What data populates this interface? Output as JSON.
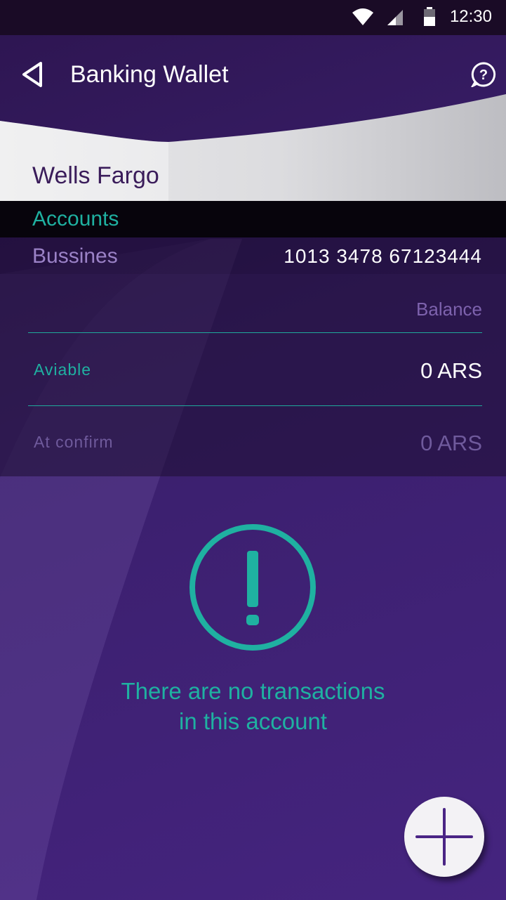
{
  "status_bar": {
    "time": "12:30",
    "icons": [
      "wifi-icon",
      "signal-icon",
      "battery-icon"
    ]
  },
  "header": {
    "title": "Banking Wallet",
    "back_icon": "back-arrow-icon",
    "help_icon": "help-icon"
  },
  "bank": {
    "name": "Wells Fargo"
  },
  "accounts": {
    "section_label": "Accounts",
    "selected": {
      "type": "Bussines",
      "number": "1013 3478 67123444"
    }
  },
  "balance": {
    "header": "Balance",
    "rows": [
      {
        "label": "Aviable",
        "value": "0 ARS"
      },
      {
        "label": "At confirm",
        "value": "0 ARS"
      }
    ]
  },
  "empty_state": {
    "icon": "alert-icon",
    "line1": "There are no transactions",
    "line2": "in this account"
  },
  "fab": {
    "icon": "plus-icon"
  },
  "colors": {
    "accent": "#1fb1a1",
    "purple_text": "#9b82c7",
    "background": "#3d2270",
    "status_bar": "#1a0b26"
  }
}
